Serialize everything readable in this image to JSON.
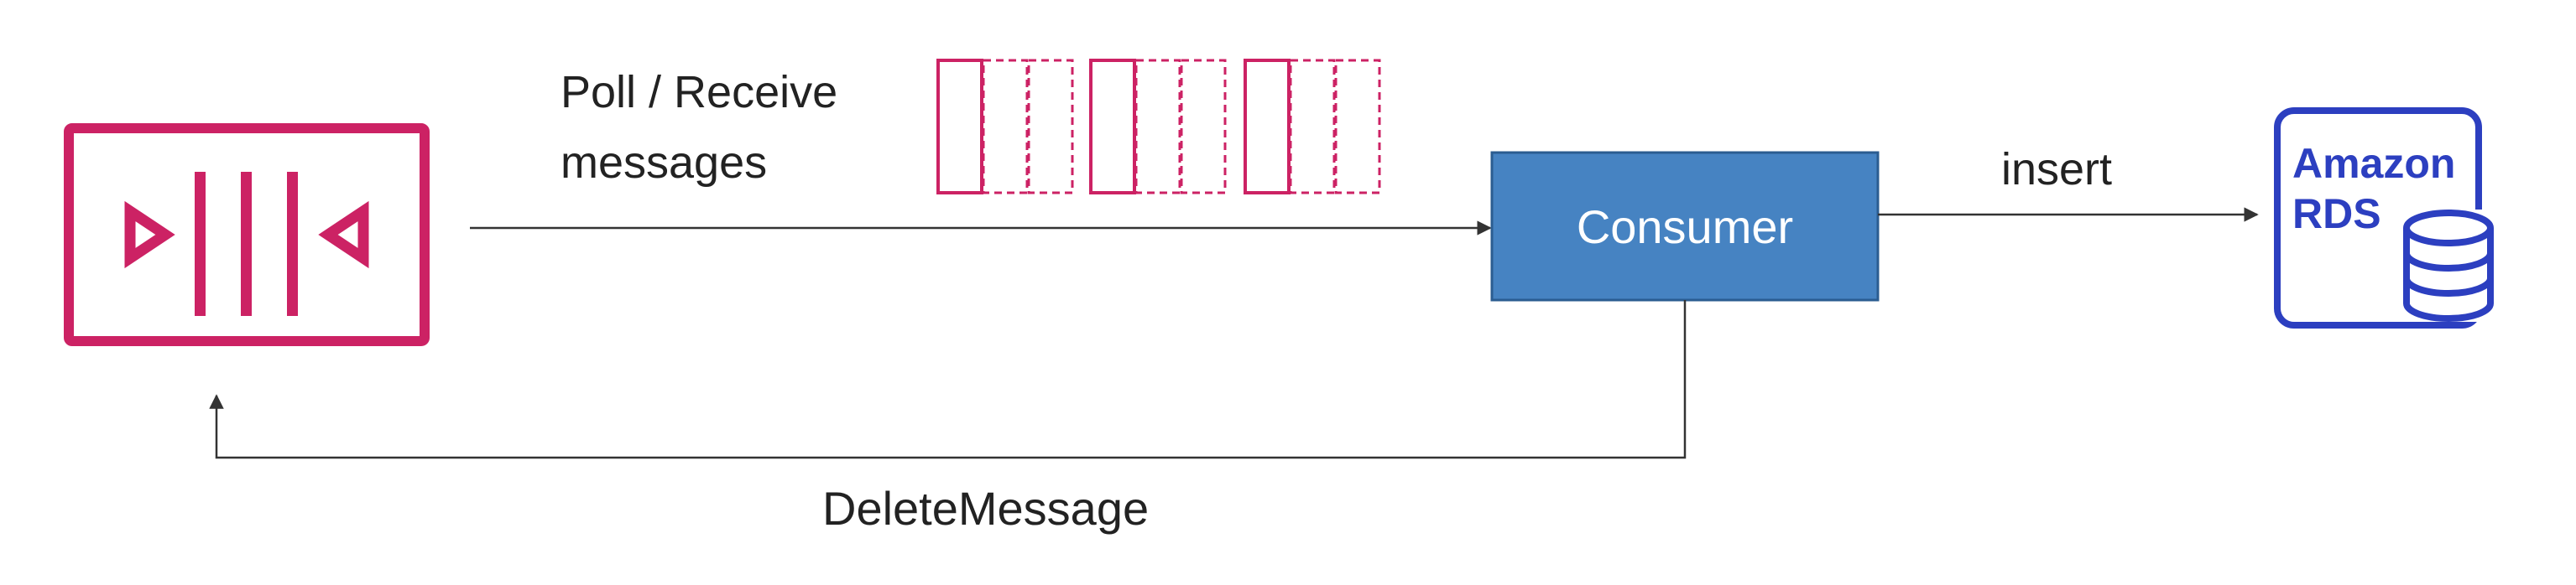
{
  "colors": {
    "queue": "#cc2264",
    "consumer_fill": "#4683c2",
    "consumer_stroke": "#2b5d91",
    "rds": "#2c3fc0",
    "arrow": "#333333",
    "text": "#222222"
  },
  "queue": {
    "icon": "sqs-queue-icon"
  },
  "poll_label": {
    "line1": "Poll / Receive",
    "line2": "messages"
  },
  "consumer": {
    "label": "Consumer"
  },
  "insert_label": "insert",
  "delete_label": "DeleteMessage",
  "rds": {
    "line1": "Amazon",
    "line2": "RDS",
    "icon": "database-icon"
  },
  "messages": {
    "groups": 3,
    "per_group": 3,
    "style": "first solid, rest dashed"
  }
}
